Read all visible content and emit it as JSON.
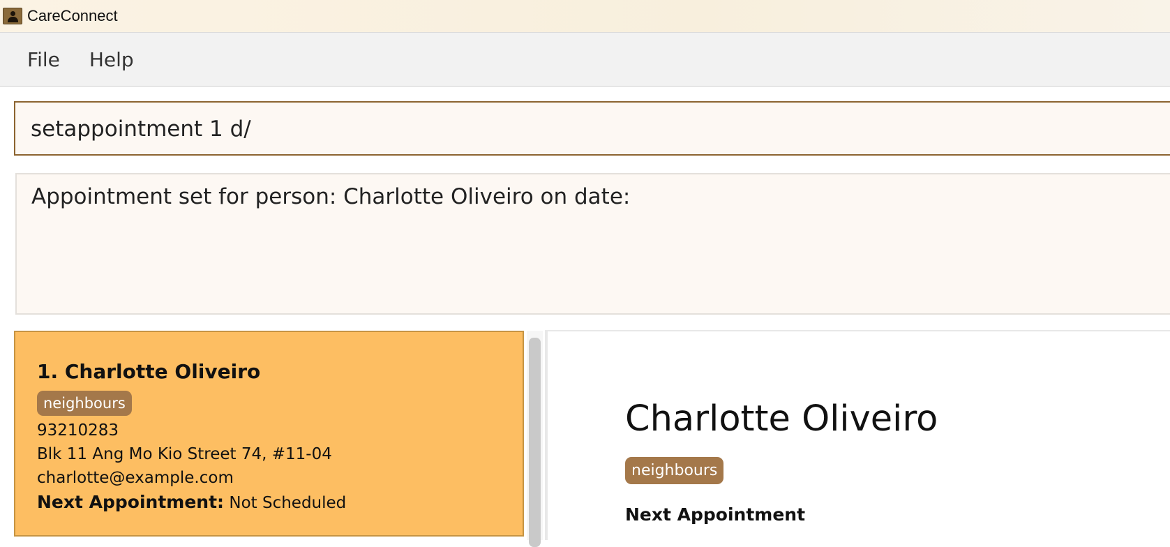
{
  "window": {
    "title": "CareConnect",
    "icon": "address-book-icon"
  },
  "menu": {
    "items": [
      {
        "label": "File"
      },
      {
        "label": "Help"
      }
    ]
  },
  "command": {
    "value": "setappointment 1 d/"
  },
  "result": {
    "text": "Appointment set for person: Charlotte Oliveiro on date:"
  },
  "person_list": {
    "items": [
      {
        "index_name": "1. Charlotte Oliveiro",
        "tags": [
          "neighbours"
        ],
        "phone": "93210283",
        "address": "Blk 11 Ang Mo Kio Street 74, #11-04",
        "email": "charlotte@example.com",
        "appointment_label": "Next Appointment:",
        "appointment_value": "Not Scheduled"
      }
    ]
  },
  "detail": {
    "name": "Charlotte Oliveiro",
    "tags": [
      "neighbours"
    ],
    "appointment_heading": "Next Appointment"
  },
  "colors": {
    "selected_card": "#fdbe62",
    "tag": "#a4784a",
    "command_border": "#8c6430",
    "panel_background": "#fdf8f3"
  }
}
